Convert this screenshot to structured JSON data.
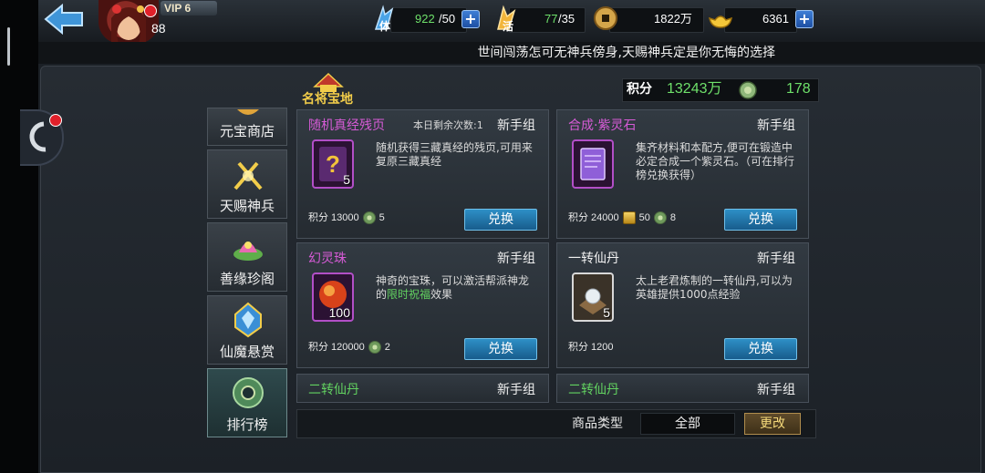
{
  "topbar": {
    "vip_label": "VIP 6",
    "level": "88",
    "stamina": {
      "icon": "stamina-icon",
      "label": "体",
      "current": "922",
      "max": "/50"
    },
    "energy": {
      "icon": "energy-icon",
      "label": "活",
      "current": "77",
      "max": "/35"
    },
    "coins": {
      "icon": "copper-coin-icon",
      "value": "1822万"
    },
    "ingots": {
      "icon": "gold-ingot-icon",
      "value": "6361"
    },
    "plus_symbol": "+"
  },
  "marquee": "世间闯荡怎可无神兵傍身,天赐神兵定是你无悔的选择",
  "shop": {
    "title": "名将宝地",
    "points_label": "积分",
    "points_value": "13243万",
    "jade_value": "178"
  },
  "tabs": [
    {
      "label": "元宝商店",
      "icon": "treasure-icon",
      "active": false
    },
    {
      "label": "天赐神兵",
      "icon": "crossed-swords-icon",
      "active": false
    },
    {
      "label": "善缘珍阁",
      "icon": "lotus-icon",
      "active": false
    },
    {
      "label": "仙魔悬赏",
      "icon": "crystal-icon",
      "active": false
    },
    {
      "label": "排行榜",
      "icon": "jade-ring-icon",
      "active": true
    }
  ],
  "cards": [
    {
      "name": "随机真经残页",
      "tier": "新手组",
      "remaining": "本日剩余次数:1",
      "icon": "question-scroll-icon",
      "count": "5",
      "desc": "随机获得三藏真经的残页,可用来复原三藏真经",
      "cost_label": "积分 13000",
      "cost_jade": "5",
      "cost_gold": "",
      "button": "兑换"
    },
    {
      "name": "合成·紫灵石",
      "tier": "新手组",
      "remaining": "",
      "icon": "purple-scroll-icon",
      "count": "",
      "desc": "集齐材料和本配方,便可在锻造中必定合成一个紫灵石。（可在排行榜兑换获得）",
      "cost_label": "积分 24000",
      "cost_gold": "50",
      "cost_jade": "8",
      "button": "兑换"
    },
    {
      "name": "幻灵珠",
      "tier": "新手组",
      "remaining": "",
      "icon": "fire-orb-icon",
      "count": "100",
      "desc_pre": "神奇的宝珠，可以激活帮派神龙的",
      "desc_highlight": "限时祝福",
      "desc_post": "效果",
      "cost_label": "积分 120000",
      "cost_jade": "2",
      "button": "兑换"
    },
    {
      "name": "一转仙丹",
      "tier": "新手组",
      "remaining": "",
      "icon": "pearl-pill-icon",
      "count": "5",
      "desc": "太上老君炼制的一转仙丹,可以为英雄提供1000点经验",
      "cost_label": "积分 1200",
      "button": "兑换"
    },
    {
      "name": "二转仙丹",
      "tier": "新手组"
    },
    {
      "name": "二转仙丹",
      "tier": "新手组"
    }
  ],
  "filter": {
    "label": "商品类型",
    "selected": "全部",
    "change_button": "更改"
  },
  "colors": {
    "points_green": "#6ee06a",
    "purple_name": "#d65bd6",
    "green_name": "#62d260",
    "exchange_blue": "#2e8fc6",
    "change_gold": "#f4d879"
  }
}
